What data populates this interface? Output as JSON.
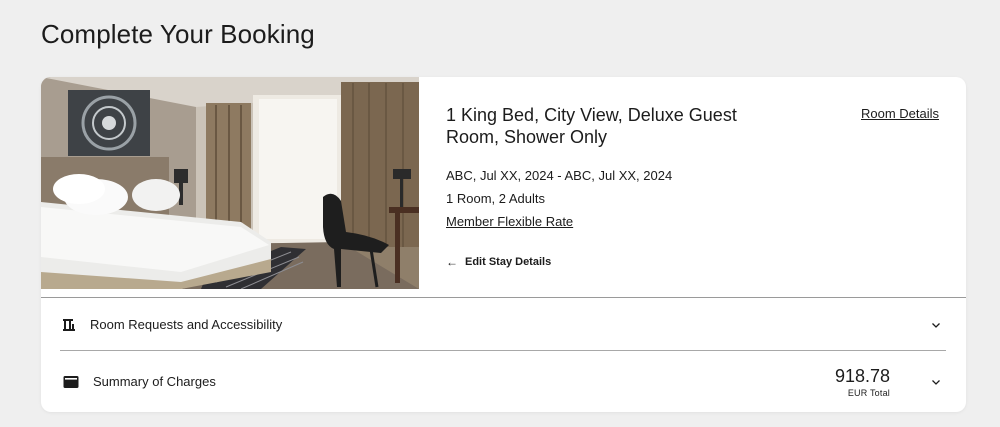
{
  "page": {
    "title": "Complete Your Booking"
  },
  "room": {
    "name": "1 King Bed, City View, Deluxe Guest Room, Shower Only",
    "details_link": "Room Details",
    "dates": "ABC, Jul XX, 2024 - ABC, Jul XX, 2024",
    "occupancy": "1 Room, 2 Adults",
    "rate": "Member Flexible Rate",
    "edit_label": "Edit Stay Details",
    "image_icon": "hotel-room-photo"
  },
  "sections": {
    "requests": {
      "label": "Room Requests and Accessibility",
      "icon": "accessibility-icon"
    },
    "charges": {
      "label": "Summary of Charges",
      "icon": "wallet-icon",
      "amount": "918.78",
      "caption": "EUR Total"
    }
  },
  "colors": {
    "background": "#efefef",
    "card": "#ffffff",
    "text": "#1c1c1c",
    "divider": "#9a9a9a"
  }
}
